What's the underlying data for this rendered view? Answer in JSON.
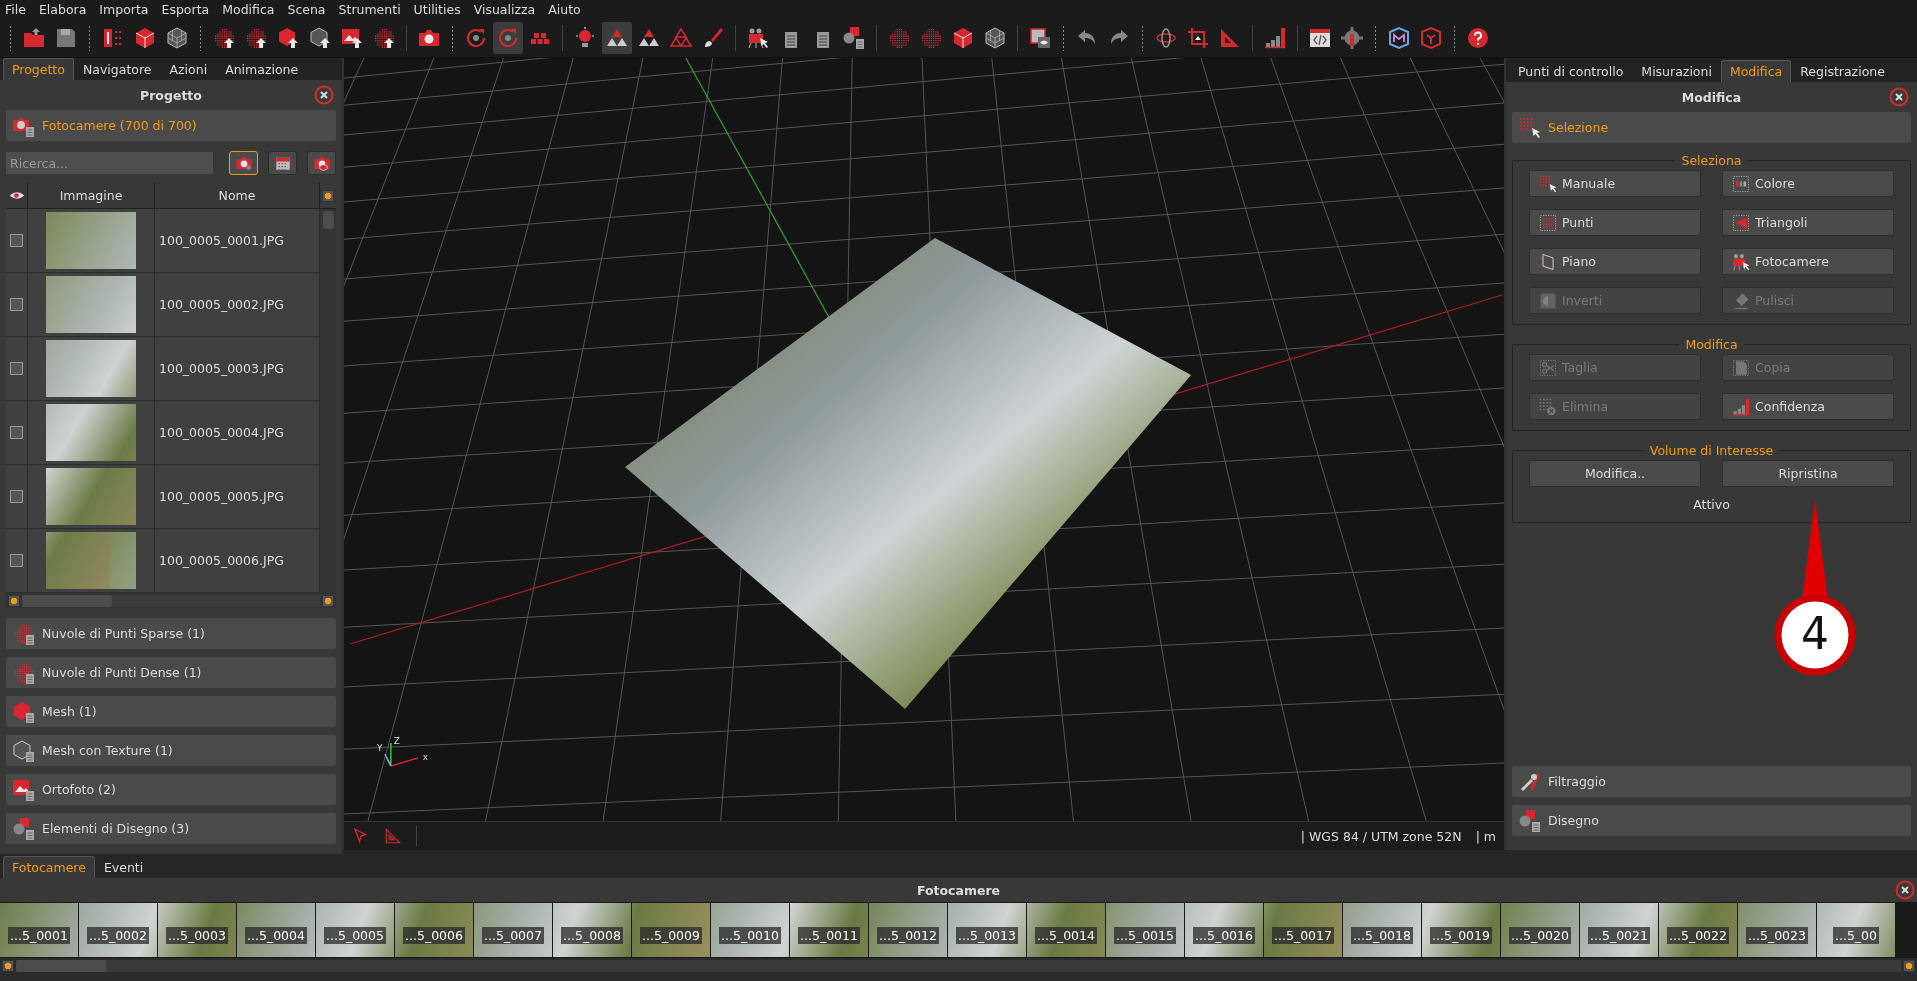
{
  "menu": [
    "File",
    "Elabora",
    "Importa",
    "Esporta",
    "Modifica",
    "Scena",
    "Strumenti",
    "Utilities",
    "Visualizza",
    "Aiuto"
  ],
  "toolbar": [
    {
      "buttons": [
        {
          "pressed": false
        },
        {
          "pressed": false
        }
      ]
    },
    {
      "buttons": [
        {
          "pressed": false
        },
        {
          "pressed": false
        },
        {
          "pressed": false
        }
      ]
    },
    {
      "buttons": [
        {
          "pressed": false
        },
        {
          "pressed": false
        },
        {
          "pressed": false
        },
        {
          "pressed": false
        },
        {
          "pressed": false
        },
        {
          "pressed": false
        }
      ]
    },
    {
      "buttons": [
        {
          "pressed": false
        }
      ]
    },
    {
      "buttons": [
        {
          "pressed": false
        },
        {
          "pressed": true
        },
        {
          "pressed": false
        }
      ]
    },
    {
      "buttons": [
        {
          "pressed": false
        },
        {
          "pressed": true
        },
        {
          "pressed": false
        },
        {
          "pressed": false
        },
        {
          "pressed": false
        }
      ]
    },
    {
      "buttons": [
        {
          "pressed": false
        },
        {
          "pressed": false
        },
        {
          "pressed": false
        },
        {
          "pressed": false
        }
      ]
    },
    {
      "buttons": [
        {
          "pressed": false
        },
        {
          "pressed": false
        },
        {
          "pressed": false
        },
        {
          "pressed": false
        }
      ]
    },
    {
      "buttons": [
        {
          "pressed": false
        }
      ]
    },
    {
      "buttons": [
        {
          "pressed": false
        },
        {
          "pressed": false
        }
      ]
    },
    {
      "buttons": [
        {
          "pressed": false
        },
        {
          "pressed": false
        },
        {
          "pressed": false
        }
      ]
    },
    {
      "buttons": [
        {
          "pressed": false
        }
      ]
    },
    {
      "buttons": [
        {
          "pressed": false
        },
        {
          "pressed": false
        }
      ]
    },
    {
      "buttons": [
        {
          "pressed": false
        },
        {
          "pressed": false
        }
      ]
    },
    {
      "buttons": [
        {
          "pressed": false
        }
      ]
    }
  ],
  "left_panel": {
    "tabs": [
      {
        "label": "Progetto",
        "selected": true
      },
      {
        "label": "Navigatore",
        "selected": false
      },
      {
        "label": "Azioni",
        "selected": false
      },
      {
        "label": "Animazione",
        "selected": false
      }
    ],
    "title": "Progetto",
    "cameras": {
      "header": "Fotocamere (700 di 700)",
      "search": {
        "placeholder": "Ricerca..."
      },
      "filters": [
        {
          "selected": true
        },
        {
          "selected": false
        },
        {
          "selected": false
        }
      ],
      "columns": [
        "Immagine",
        "Nome"
      ],
      "rows": [
        {
          "name": "100_0005_0001.JPG",
          "checked": false
        },
        {
          "name": "100_0005_0002.JPG",
          "checked": false
        },
        {
          "name": "100_0005_0003.JPG",
          "checked": false
        },
        {
          "name": "100_0005_0004.JPG",
          "checked": false
        },
        {
          "name": "100_0005_0005.JPG",
          "checked": false
        },
        {
          "name": "100_0005_0006.JPG",
          "checked": false
        }
      ]
    },
    "sections": [
      "Nuvole di Punti Sparse (1)",
      "Nuvole di Punti Dense (1)",
      "Mesh (1)",
      "Mesh con Texture (1)",
      "Ortofoto (2)",
      "Elementi di Disegno (3)"
    ]
  },
  "viewport": {
    "axis_labels": [
      "Y",
      "Z",
      "x"
    ],
    "status": [
      "| WGS 84 / UTM zone 52N",
      "| m"
    ],
    "callout": "4"
  },
  "right_panel": {
    "tabs": [
      {
        "label": "Punti di controllo",
        "selected": false
      },
      {
        "label": "Misurazioni",
        "selected": false
      },
      {
        "label": "Modifica",
        "selected": true
      },
      {
        "label": "Registrazione",
        "selected": false
      }
    ],
    "title": "Modifica",
    "section": "Selezione",
    "groups": [
      {
        "title": "Seleziona",
        "buttons": [
          {
            "label": "Manuale",
            "disabled": false
          },
          {
            "label": "Colore",
            "disabled": false
          },
          {
            "label": "Punti",
            "disabled": false
          },
          {
            "label": "Triangoli",
            "disabled": false
          },
          {
            "label": "Piano",
            "disabled": false
          },
          {
            "label": "Fotocamere",
            "disabled": false
          },
          {
            "label": "Inverti",
            "disabled": true
          },
          {
            "label": "Pulisci",
            "disabled": true
          }
        ]
      },
      {
        "title": "Modifica",
        "buttons": [
          {
            "label": "Taglia",
            "disabled": true
          },
          {
            "label": "Copia",
            "disabled": true
          },
          {
            "label": "Elimina",
            "disabled": true
          },
          {
            "label": "Confidenza",
            "disabled": false
          }
        ]
      },
      {
        "title": "Volume di Interesse",
        "buttons": [
          {
            "label": "Modifica..",
            "disabled": false
          },
          {
            "label": "Ripristina",
            "disabled": false
          }
        ],
        "status": "Attivo"
      }
    ],
    "footer_sections": [
      "Filtraggio",
      "Disegno"
    ]
  },
  "bottom_panel": {
    "tabs": [
      {
        "label": "Fotocamere",
        "selected": true
      },
      {
        "label": "Eventi",
        "selected": false
      }
    ],
    "title": "Fotocamere",
    "thumbnails": [
      "...5_0001",
      "...5_0002",
      "...5_0003",
      "...5_0004",
      "...5_0005",
      "...5_0006",
      "...5_0007",
      "...5_0008",
      "...5_0009",
      "...5_0010",
      "...5_0011",
      "...5_0012",
      "...5_0013",
      "...5_0014",
      "...5_0015",
      "...5_0016",
      "...5_0017",
      "...5_0018",
      "...5_0019",
      "...5_0020",
      "...5_0021",
      "...5_0022",
      "...5_0023",
      "...5_00"
    ]
  }
}
